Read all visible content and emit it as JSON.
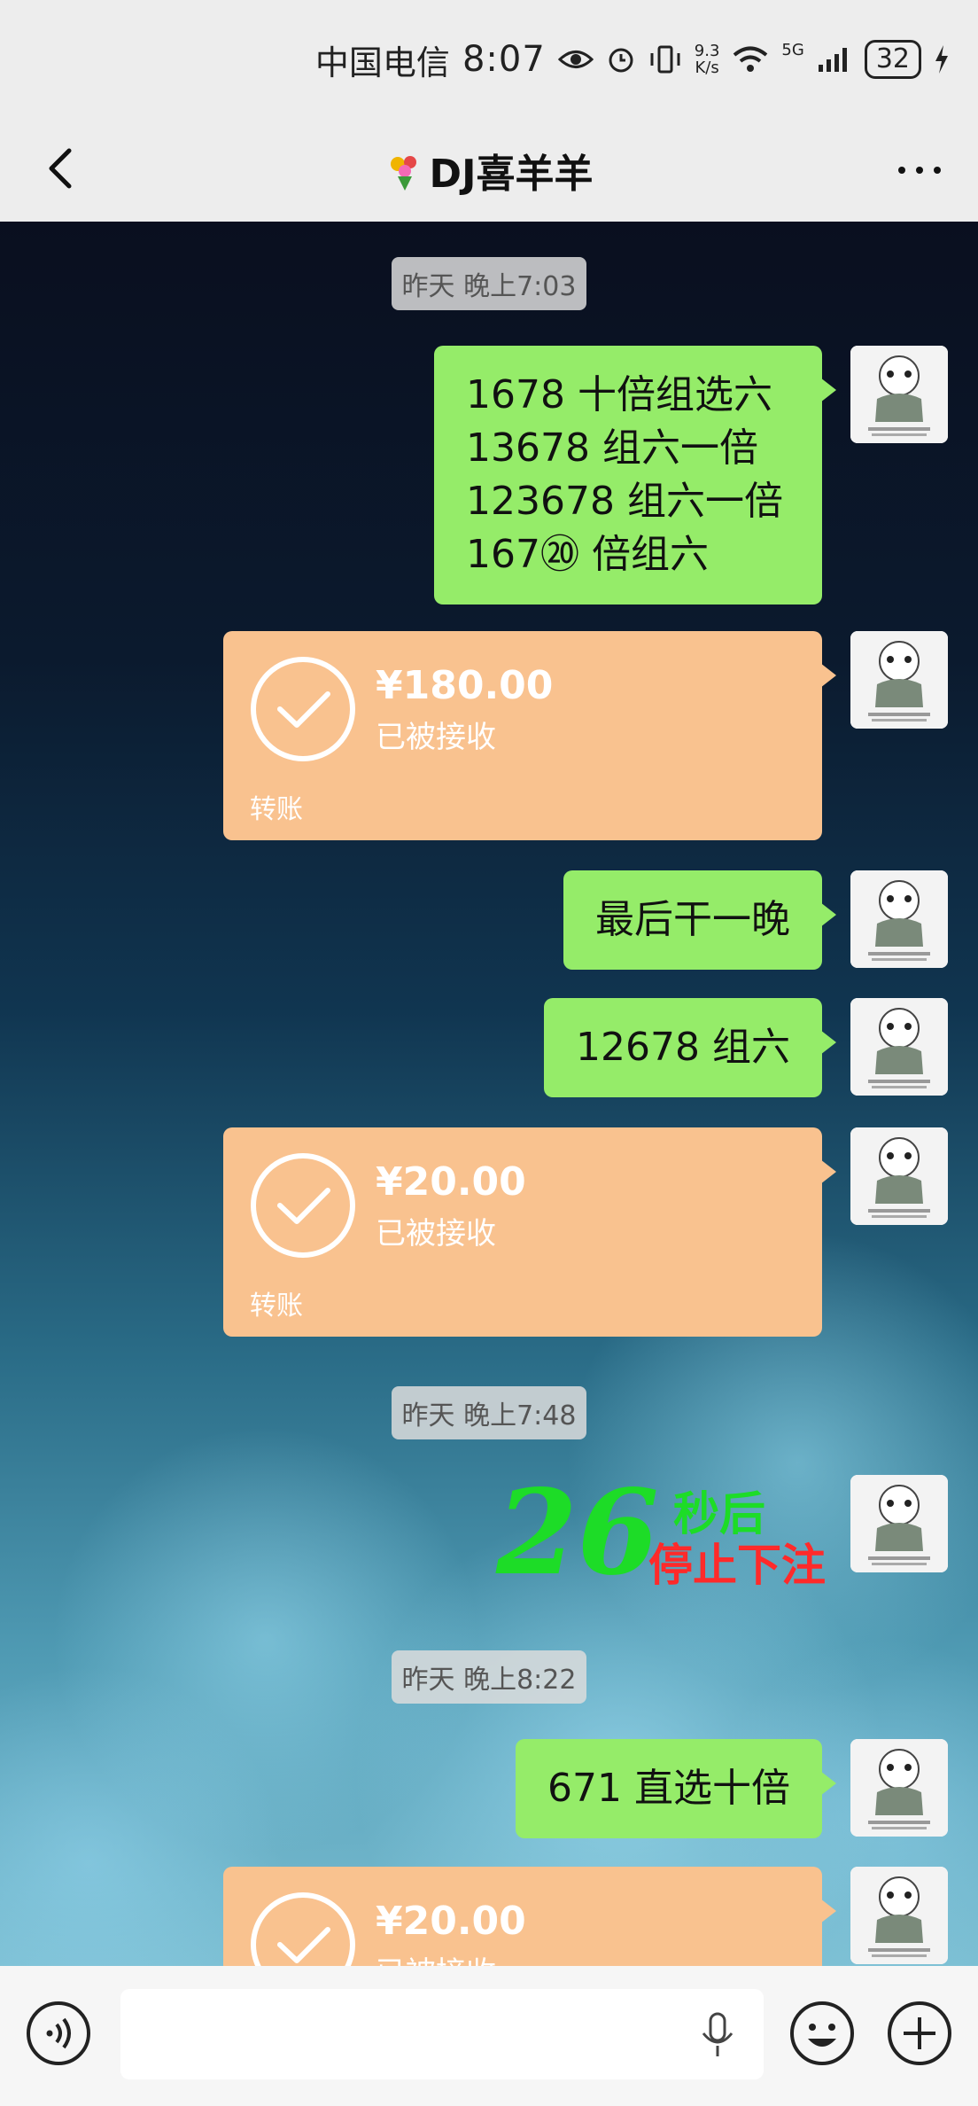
{
  "status_bar": {
    "carrier": "中国电信",
    "time": "8:07",
    "net_speed_value": "9.3",
    "net_speed_unit": "K/s",
    "network_type": "5G",
    "battery": "32"
  },
  "nav": {
    "title": "DJ喜羊羊",
    "back_icon": "chevron-left-icon",
    "more_icon": "more-dots-icon"
  },
  "chat": {
    "timestamps": [
      "昨天 晚上7:03",
      "昨天 晚上7:48",
      "昨天 晚上8:22"
    ],
    "msg1": {
      "lines": [
        "1678 十倍组选六",
        "13678 组六一倍",
        "123678 组六一倍",
        "167⑳ 倍组六"
      ]
    },
    "transfer1": {
      "amount": "¥180.00",
      "status": "已被接收",
      "label": "转账"
    },
    "msg2": {
      "text": "最后干一晚"
    },
    "msg3": {
      "text": "12678 组六"
    },
    "transfer2": {
      "amount": "¥20.00",
      "status": "已被接收",
      "label": "转账"
    },
    "sticker": {
      "number": "26",
      "line1": "秒后",
      "line2": "停止下注"
    },
    "msg4": {
      "text": "671 直选十倍"
    },
    "transfer3": {
      "amount": "¥20.00",
      "status": "已被接收"
    },
    "colors": {
      "bubble": "#95ec69",
      "transfer": "#f9c28f"
    }
  },
  "input_bar": {
    "placeholder": "",
    "icons": [
      "voice-icon",
      "mic-icon",
      "emoji-icon",
      "plus-icon"
    ]
  }
}
